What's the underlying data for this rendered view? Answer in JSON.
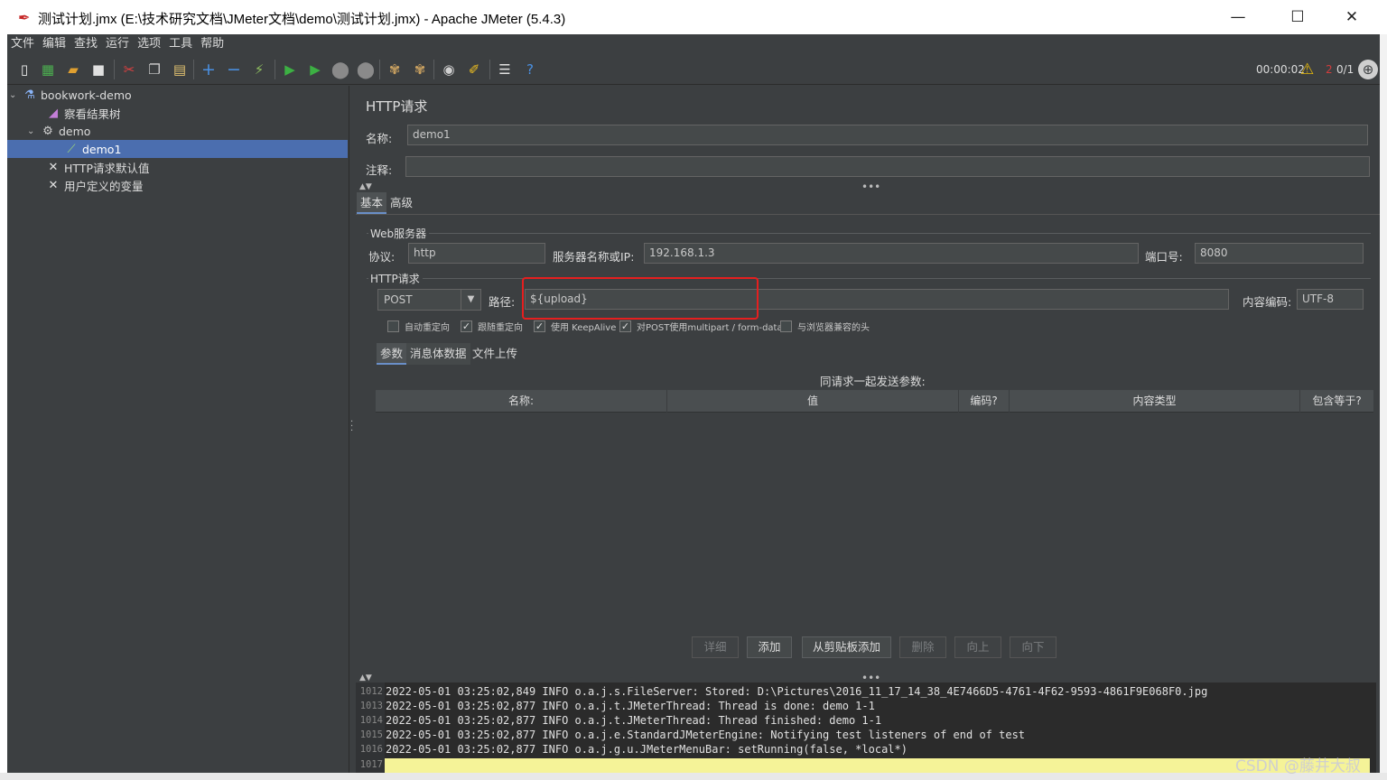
{
  "window": {
    "title": "测试计划.jmx (E:\\技术研究文档\\JMeter文档\\demo\\测试计划.jmx) - Apache JMeter (5.4.3)",
    "minimize": "—",
    "maximize": "☐",
    "close": "✕"
  },
  "menu": [
    "文件",
    "编辑",
    "查找",
    "运行",
    "选项",
    "工具",
    "帮助"
  ],
  "status": {
    "timer": "00:00:02",
    "errors": "2",
    "threads": "0/1"
  },
  "tree": {
    "root": "bookwork-demo",
    "results_tree": "察看结果树",
    "thread_group": "demo",
    "sampler": "demo1",
    "http_defaults": "HTTP请求默认值",
    "user_vars": "用户定义的变量"
  },
  "panel": {
    "title": "HTTP请求",
    "name_label": "名称:",
    "name_value": "demo1",
    "comment_label": "注释:",
    "comment_value": "",
    "tabs": [
      "基本",
      "高级"
    ],
    "web_server_group": "Web服务器",
    "protocol_label": "协议:",
    "protocol_value": "http",
    "server_label": "服务器名称或IP:",
    "server_value": "192.168.1.3",
    "port_label": "端口号:",
    "port_value": "8080",
    "http_group": "HTTP请求",
    "method_value": "POST",
    "path_label": "路径:",
    "path_value": "${upload}",
    "encoding_label": "内容编码:",
    "encoding_value": "UTF-8",
    "checkboxes": [
      {
        "label": "自动重定向",
        "checked": false
      },
      {
        "label": "跟随重定向",
        "checked": true
      },
      {
        "label": "使用 KeepAlive",
        "checked": true
      },
      {
        "label": "对POST使用multipart / form-data",
        "checked": true
      },
      {
        "label": "与浏览器兼容的头",
        "checked": false
      }
    ],
    "sub_tabs": [
      "参数",
      "消息体数据",
      "文件上传"
    ],
    "params_caption": "同请求一起发送参数:",
    "columns": [
      "名称:",
      "值",
      "编码?",
      "内容类型",
      "包含等于?"
    ],
    "buttons": [
      "详细",
      "添加",
      "从剪贴板添加",
      "删除",
      "向上",
      "向下"
    ]
  },
  "log": {
    "line_numbers": [
      "1012",
      "1013",
      "1014",
      "1015",
      "1016",
      "1017"
    ],
    "lines": [
      "2022-05-01 03:25:02,849 INFO o.a.j.s.FileServer: Stored: D:\\Pictures\\2016_11_17_14_38_4E7466D5-4761-4F62-9593-4861F9E068F0.jpg",
      "2022-05-01 03:25:02,877 INFO o.a.j.t.JMeterThread: Thread is done: demo 1-1",
      "2022-05-01 03:25:02,877 INFO o.a.j.t.JMeterThread: Thread finished: demo 1-1",
      "2022-05-01 03:25:02,877 INFO o.a.j.e.StandardJMeterEngine: Notifying test listeners of end of test",
      "2022-05-01 03:25:02,877 INFO o.a.j.g.u.JMeterMenuBar: setRunning(false, *local*)",
      ""
    ]
  },
  "watermark": "CSDN @藤井大叔",
  "colors": {
    "bg": "#3c3f41",
    "selection": "#4b6eaf",
    "highlight": "#e51f1f",
    "current_line": "#f5f398"
  }
}
